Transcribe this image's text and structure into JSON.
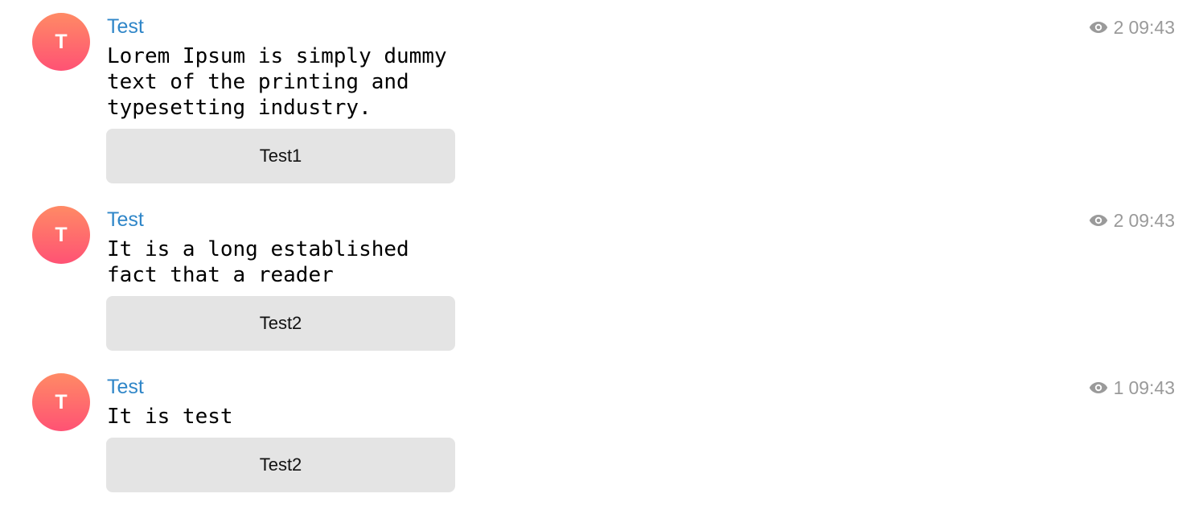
{
  "messages": [
    {
      "avatar_letter": "T",
      "sender": "Test",
      "text": "Lorem Ipsum is simply dummy\ntext of the printing and\ntypesetting industry.",
      "views": "2",
      "time": "09:43",
      "button_label": "Test1"
    },
    {
      "avatar_letter": "T",
      "sender": "Test",
      "text": "It is a long established\nfact that a reader",
      "views": "2",
      "time": "09:43",
      "button_label": "Test2"
    },
    {
      "avatar_letter": "T",
      "sender": "Test",
      "text": "It is test",
      "views": "1",
      "time": "09:43",
      "button_label": "Test2"
    }
  ],
  "colors": {
    "sender_name": "#2f86c8",
    "avatar_gradient_top": "#ff8a65",
    "avatar_gradient_bottom": "#ff5274",
    "meta_text": "#9a9a9a",
    "button_background": "#e4e4e4"
  },
  "icons": {
    "views": "eye-icon"
  }
}
